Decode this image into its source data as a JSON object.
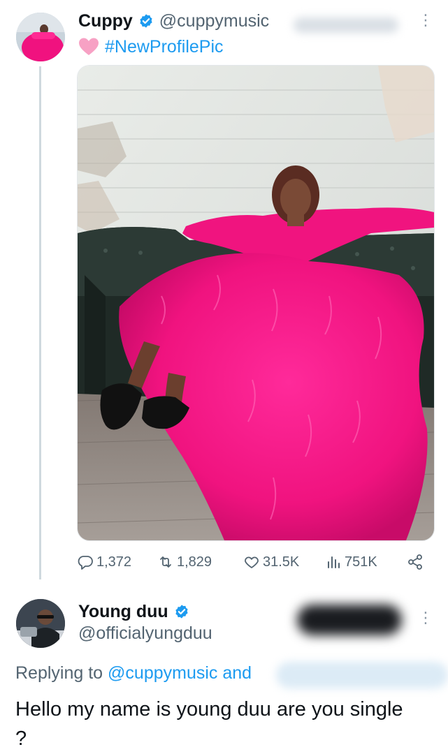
{
  "tweet1": {
    "name": "Cuppy",
    "handle": "@cuppymusic",
    "hashtag": "#NewProfilePic",
    "stats": {
      "replies": "1,372",
      "reposts": "1,829",
      "likes": "31.5K",
      "views": "751K"
    }
  },
  "tweet2": {
    "name": "Young duu",
    "handle": "@officialyungduu",
    "replying_prefix": "Replying to",
    "replying_mention": "@cuppymusic and",
    "text": "Hello my name is young duu are you single ?"
  },
  "colors": {
    "accent": "#1d9bf0",
    "verified": "#1d9bf0",
    "secondary_text": "#536471",
    "thread_line": "#cfd9de"
  },
  "icons": [
    "verified-badge-icon",
    "pink-heart-emoji",
    "reply-icon",
    "repost-icon",
    "like-icon",
    "views-icon",
    "share-icon",
    "more-icon"
  ]
}
